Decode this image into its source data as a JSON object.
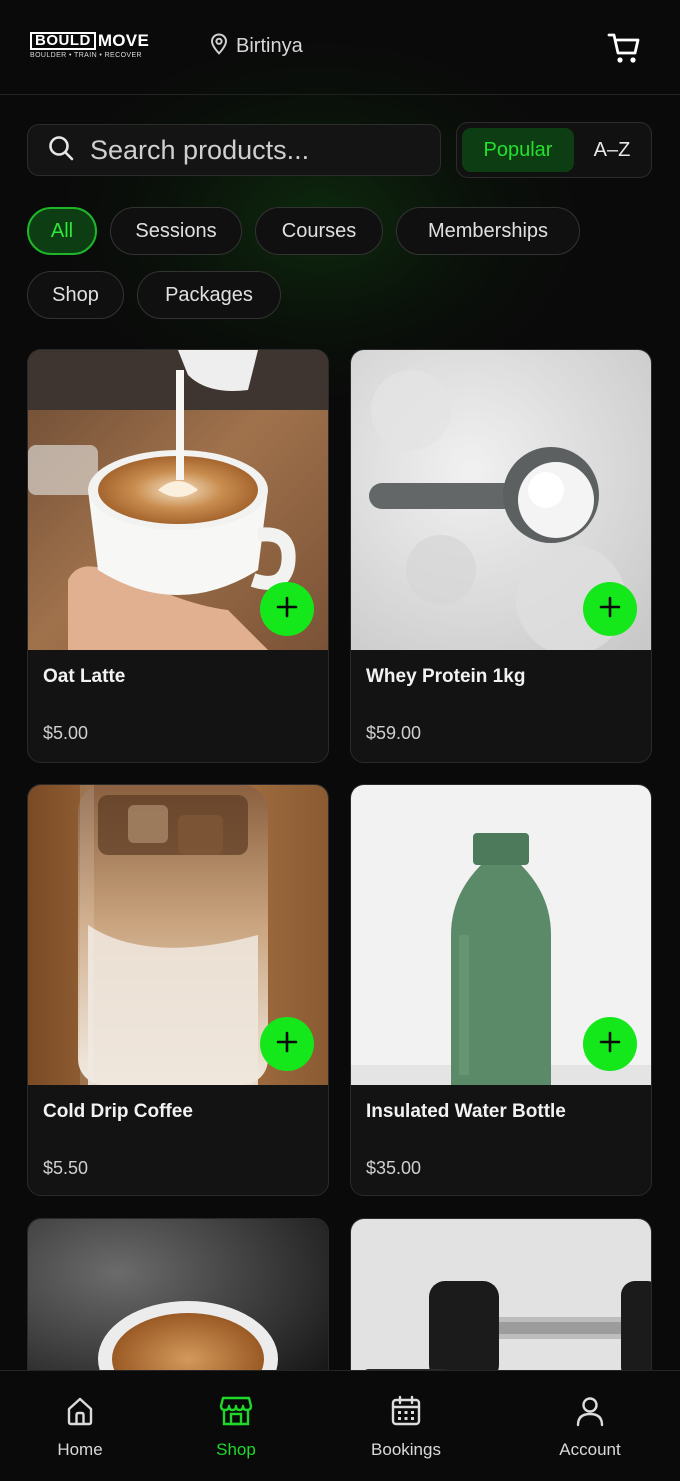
{
  "header": {
    "logo_box": "BOULD",
    "logo_move": "MOVE",
    "logo_tagline": "BOULDER • TRAIN • RECOVER",
    "location": "Birtinya",
    "icons": {
      "location": "map-pin-icon",
      "cart": "shopping-cart-icon"
    }
  },
  "search": {
    "placeholder": "Search products...",
    "value": ""
  },
  "sort": {
    "options": [
      "Popular",
      "A–Z"
    ],
    "selected": "Popular"
  },
  "categories": {
    "items": [
      "All",
      "Sessions",
      "Courses",
      "Memberships",
      "Shop",
      "Packages"
    ],
    "selected": "All"
  },
  "products": [
    {
      "name": "Oat Latte",
      "price": "$5.00"
    },
    {
      "name": "Whey Protein 1kg",
      "price": "$59.00"
    },
    {
      "name": "Cold Drip Coffee",
      "price": "$5.50"
    },
    {
      "name": "Insulated Water Bottle",
      "price": "$35.00"
    }
  ],
  "bottom_nav": {
    "items": [
      {
        "label": "Home",
        "icon": "home-icon"
      },
      {
        "label": "Shop",
        "icon": "store-icon"
      },
      {
        "label": "Bookings",
        "icon": "calendar-icon"
      },
      {
        "label": "Account",
        "icon": "user-icon"
      }
    ],
    "active": "Shop"
  },
  "colors": {
    "accent": "#14e81a",
    "active_bg": "#0d3d12",
    "background": "#0a0a0a",
    "card": "#131313"
  }
}
